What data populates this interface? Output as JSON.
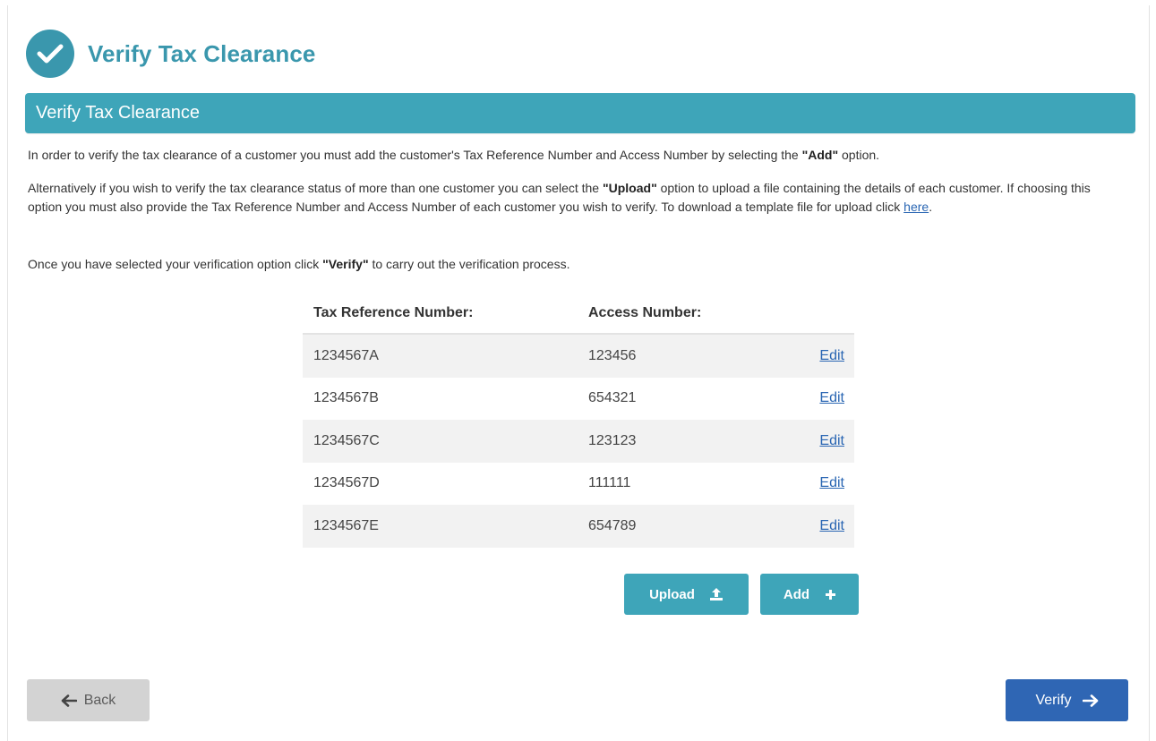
{
  "page": {
    "title": "Verify Tax Clearance",
    "section_title": "Verify Tax Clearance"
  },
  "intro": {
    "p1_before": "In order to verify the tax clearance of a customer you must add the customer's Tax Reference Number and Access Number by selecting the ",
    "p1_bold": "\"Add\"",
    "p1_after": " option.",
    "p2_before": "Alternatively if you wish to verify the tax clearance status of more than one customer you can select the ",
    "p2_bold": "\"Upload\"",
    "p2_after": " option to upload a file containing the details of each customer. If choosing this option you must also provide the Tax Reference Number and Access Number of each customer you wish to verify. To download a template file for upload click ",
    "p2_link": "here",
    "p2_end": ".",
    "p3_before": "Once you have selected your verification option click ",
    "p3_bold": "\"Verify\"",
    "p3_after": " to carry out the verification process."
  },
  "table": {
    "headers": [
      "Tax Reference Number:",
      "Access Number:"
    ],
    "rows": [
      {
        "tax_ref": "1234567A",
        "access": "123456",
        "action": "Edit"
      },
      {
        "tax_ref": "1234567B",
        "access": "654321",
        "action": "Edit"
      },
      {
        "tax_ref": "1234567C",
        "access": "123123",
        "action": "Edit"
      },
      {
        "tax_ref": "1234567D",
        "access": "111111",
        "action": "Edit"
      },
      {
        "tax_ref": "1234567E",
        "access": "654789",
        "action": "Edit"
      }
    ]
  },
  "buttons": {
    "upload": "Upload",
    "add": "Add",
    "back": "Back",
    "verify": "Verify"
  },
  "icons": {
    "header": "check-icon",
    "upload": "upload-icon",
    "add": "plus-icon",
    "back": "arrow-left-icon",
    "verify": "arrow-right-icon"
  },
  "colors": {
    "teal": "#3ea5b9",
    "title_teal": "#3a97ad",
    "verify_blue": "#2f66b4",
    "back_grey": "#d3d3d3",
    "link_blue": "#2a66b3"
  }
}
